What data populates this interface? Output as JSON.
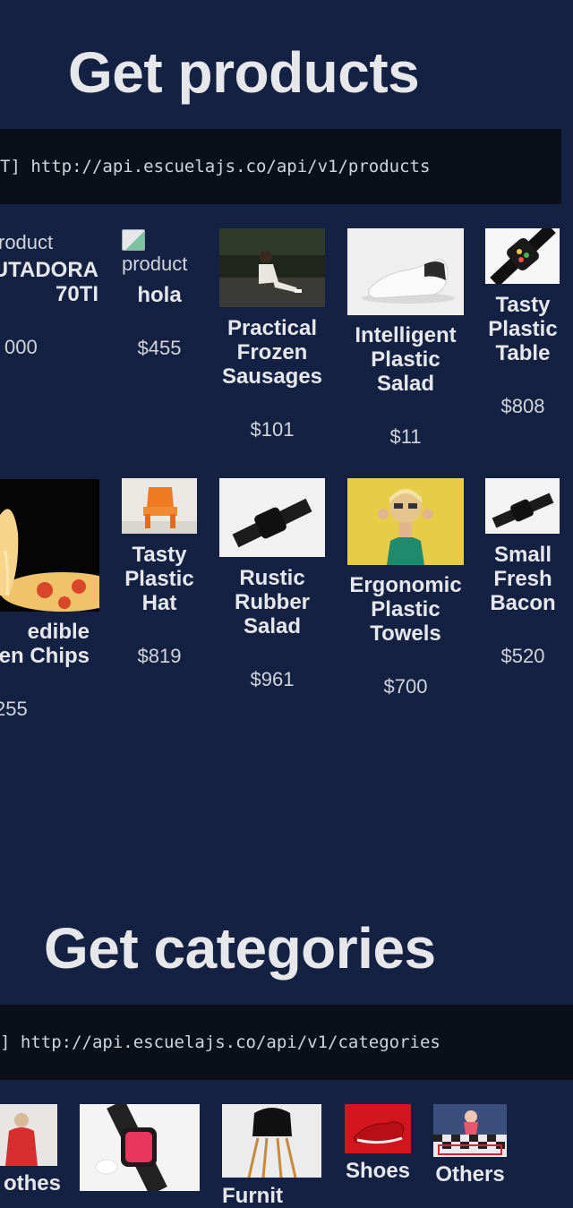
{
  "products_section": {
    "title": "Get products",
    "endpoint": "T] http://api.escuelajs.co/api/v1/products",
    "row1": [
      {
        "alt": "roduct",
        "name": "UTADORA\n70TI",
        "price": "000"
      },
      {
        "alt": "product",
        "name": "hola",
        "price": "$455"
      },
      {
        "name": "Practical\nFrozen\nSausages",
        "price": "$101"
      },
      {
        "name": "Intelligent\nPlastic\nSalad",
        "price": "$11"
      },
      {
        "name": "Tasty\nPlastic\nTable",
        "price": "$808"
      }
    ],
    "row2": [
      {
        "name": "edible\nen Chips",
        "price": "255"
      },
      {
        "name": "Tasty\nPlastic\nHat",
        "price": "$819"
      },
      {
        "name": "Rustic\nRubber\nSalad",
        "price": "$961"
      },
      {
        "name": "Ergonomic\nPlastic\nTowels",
        "price": "$700"
      },
      {
        "name": "Small\nFresh\nBacon",
        "price": "$520"
      }
    ]
  },
  "categories_section": {
    "title": "Get categories",
    "endpoint": "] http://api.escuelajs.co/api/v1/categories",
    "items": [
      {
        "name": "othes"
      },
      {
        "name": ""
      },
      {
        "name": "Furnit"
      },
      {
        "name": "Shoes"
      },
      {
        "name": "Others"
      }
    ]
  }
}
